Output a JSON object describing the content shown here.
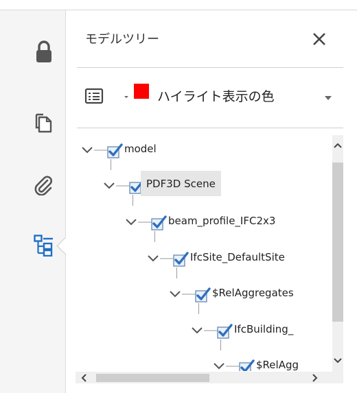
{
  "rail": {
    "items": [
      {
        "name": "lock",
        "active": false
      },
      {
        "name": "pages",
        "active": false
      },
      {
        "name": "attachments",
        "active": false
      },
      {
        "name": "model-tree",
        "active": true
      }
    ]
  },
  "panel": {
    "title": "モデルツリー",
    "close_icon": "close-icon"
  },
  "toolbar": {
    "options_icon": "list-options-icon",
    "highlight_color": "#ff0000",
    "highlight_label": "ハイライト表示の色"
  },
  "tree": {
    "nodes": [
      {
        "label": "model",
        "checked": true,
        "expanded": true,
        "selected": false
      },
      {
        "label": "PDF3D Scene",
        "checked": true,
        "expanded": true,
        "selected": true
      },
      {
        "label": "beam_profile_IFC2x3",
        "checked": true,
        "expanded": true,
        "selected": false
      },
      {
        "label": "IfcSite_DefaultSite",
        "checked": true,
        "expanded": true,
        "selected": false
      },
      {
        "label": "$RelAggregates",
        "checked": true,
        "expanded": true,
        "selected": false
      },
      {
        "label": "IfcBuilding_",
        "checked": true,
        "expanded": true,
        "selected": false
      },
      {
        "label": "$RelAgg",
        "checked": true,
        "expanded": true,
        "selected": false
      }
    ]
  },
  "colors": {
    "accent_blue": "#1f6fc5",
    "checkbox_blue": "#3a78c4"
  }
}
